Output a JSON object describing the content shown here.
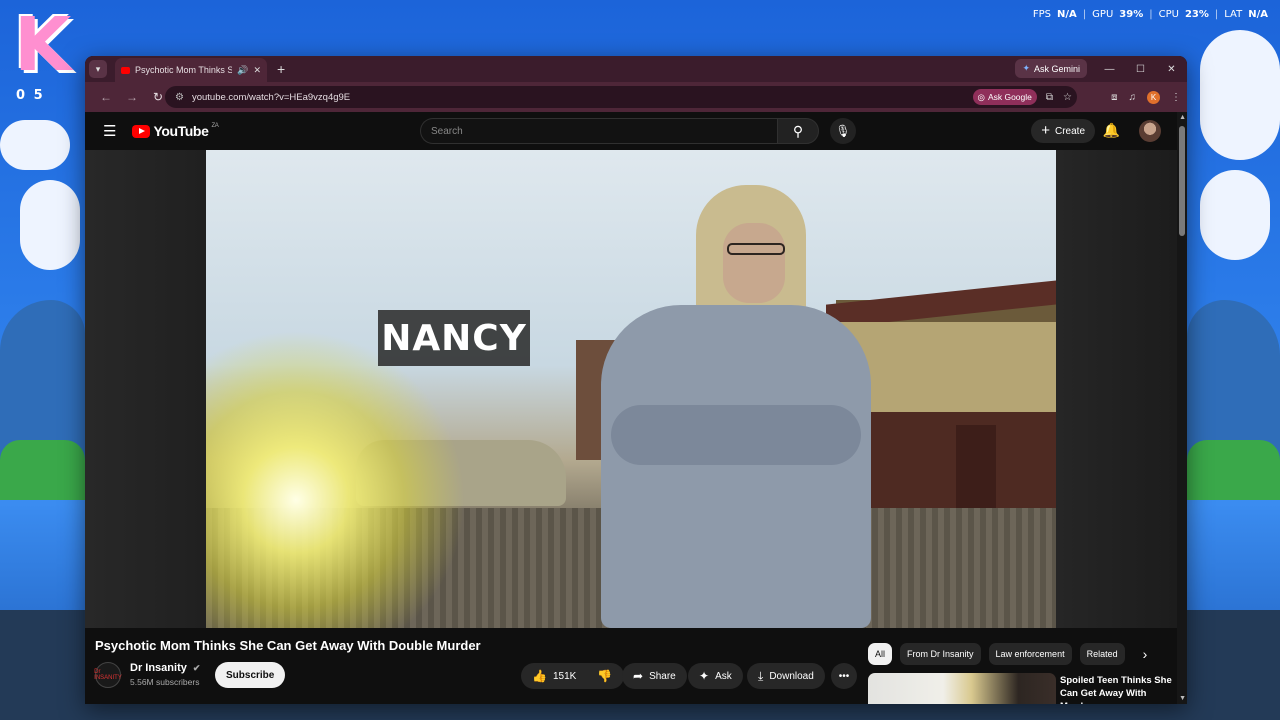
{
  "desktop": {
    "logo_letter": "K",
    "counter": "0 5",
    "perf": {
      "fps_label": "FPS",
      "fps_value": "N/A",
      "gpu_label": "GPU",
      "gpu_value": "39%",
      "cpu_label": "CPU",
      "cpu_value": "23%",
      "lat_label": "LAT",
      "lat_value": "N/A",
      "separator": "|"
    }
  },
  "browser": {
    "tab": {
      "title": "Psychotic Mom Thinks She",
      "audio_icon": "speaker-icon",
      "close": "✕"
    },
    "new_tab": "+",
    "ask_gemini": "Ask Gemini",
    "window_controls": {
      "minimize": "—",
      "maximize": "☐",
      "close": "✕"
    },
    "url": "youtube.com/watch?v=HEa9vzq4g9E",
    "ask_google": "Ask Google",
    "profile_initial": "K",
    "accent": "#4e2638"
  },
  "youtube": {
    "logo_text": "YouTube",
    "region": "ZA",
    "search_placeholder": "Search",
    "create_label": "Create",
    "video": {
      "overlay_text": "NANCY",
      "title": "Psychotic Mom Thinks She Can Get Away With Double Murder"
    },
    "channel": {
      "name": "Dr Insanity",
      "verified": "✔",
      "subscribers": "5.56M subscribers",
      "subscribe_label": "Subscribe",
      "avatar_text": "Dr INSANITY"
    },
    "actions": {
      "likes": "151K",
      "share": "Share",
      "ask": "Ask",
      "download": "Download",
      "more": "•••"
    },
    "chips": [
      "All",
      "From Dr Insanity",
      "Law enforcement",
      "Related"
    ],
    "recommended": {
      "title": "Spoiled Teen Thinks She Can Get Away With Murder"
    }
  }
}
